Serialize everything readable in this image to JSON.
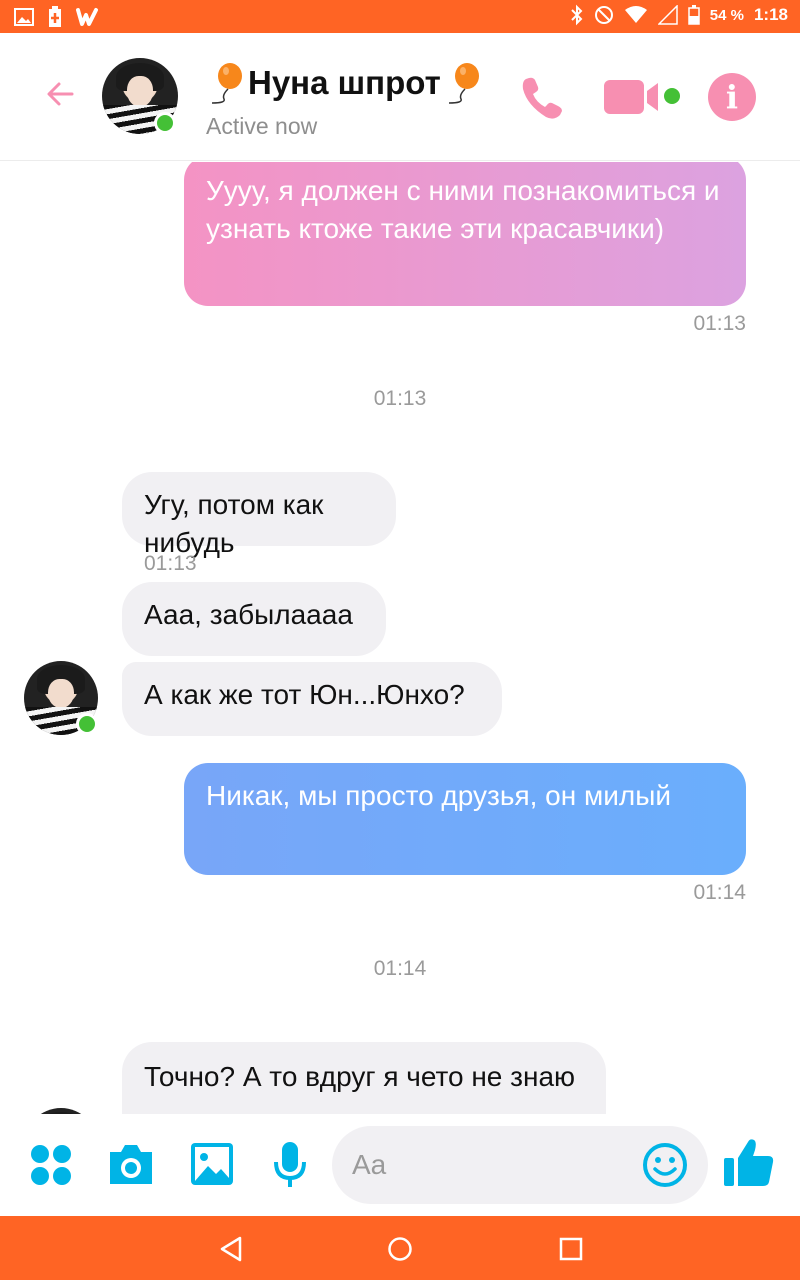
{
  "status_bar": {
    "battery": "54 %",
    "time": "1:18"
  },
  "header": {
    "contact_name": "Нуна шпрот",
    "status": "Active now",
    "info_label": "i"
  },
  "messages": [
    {
      "direction": "out",
      "text": "Уууу, я должен с ними познакомиться и узнать ктоже такие эти красавчики)",
      "time": "01:13"
    },
    {
      "direction": "separator",
      "time": "01:13"
    },
    {
      "direction": "in",
      "text": "Угу, потом как нибудь",
      "time": "01:13"
    },
    {
      "direction": "in",
      "text": "Ааа, забылаааа"
    },
    {
      "direction": "in",
      "text": "А как же тот Юн...Юнхо?"
    },
    {
      "direction": "out",
      "text": "Никак, мы просто друзья, он милый",
      "time": "01:14"
    },
    {
      "direction": "separator",
      "time": "01:14"
    },
    {
      "direction": "in",
      "text": "Точно? А то вдруг я чето не знаю"
    }
  ],
  "composer": {
    "placeholder": "Aa"
  },
  "colors": {
    "status_bar": "#ff6424",
    "accent_pink": "#f78fb1",
    "accent_blue": "#00b4e6",
    "incoming_bubble": "#f1f0f3",
    "outgoing_purple_start": "#f493c4",
    "outgoing_purple_end": "#dca2e0",
    "outgoing_blue_start": "#78a6f8",
    "outgoing_blue_end": "#6aaefc",
    "online": "#44c036"
  },
  "icons": {
    "back": "arrow-left-icon",
    "call": "phone-icon",
    "video": "video-camera-icon",
    "info": "info-icon",
    "apps": "four-dots-icon",
    "camera": "camera-icon",
    "gallery": "image-icon",
    "mic": "microphone-icon",
    "emoji": "smiley-icon",
    "like": "thumbs-up-icon"
  }
}
